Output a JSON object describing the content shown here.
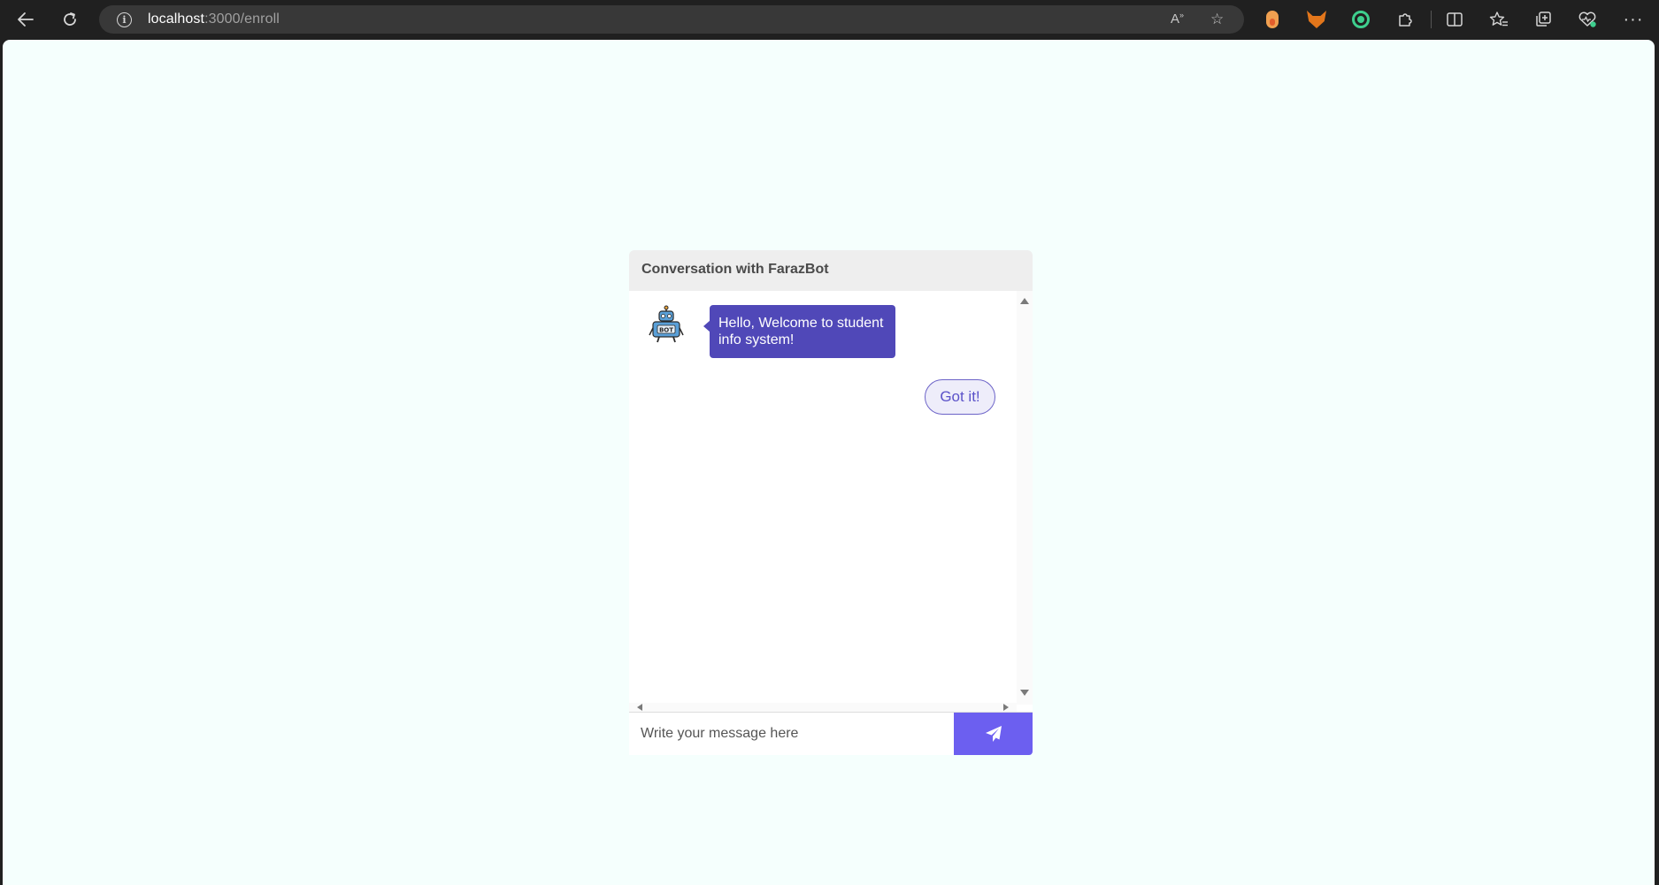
{
  "browser": {
    "url_host": "localhost",
    "url_path": ":3000/enroll",
    "icons": {
      "back": "back-arrow-icon",
      "reload": "reload-icon",
      "info": "site-info-icon",
      "read_aloud": "read-aloud-icon",
      "favorite": "star-icon",
      "extensions": "puzzle-icon",
      "split": "split-screen-icon",
      "favorites": "favorites-icon",
      "collections": "collections-icon",
      "health": "browser-essentials-icon",
      "more": "more-icon"
    }
  },
  "chat": {
    "header_title": "Conversation with FarazBot",
    "messages": [
      {
        "sender": "bot",
        "text": "Hello, Welcome to student info system!"
      }
    ],
    "options": [
      {
        "label": "Got it!"
      }
    ],
    "input_placeholder": "Write your message here",
    "colors": {
      "bot_bubble": "#5048b8",
      "send_button": "#6c5ff0",
      "option_border": "#6c63c8",
      "page_background": "#f5fffd"
    }
  }
}
